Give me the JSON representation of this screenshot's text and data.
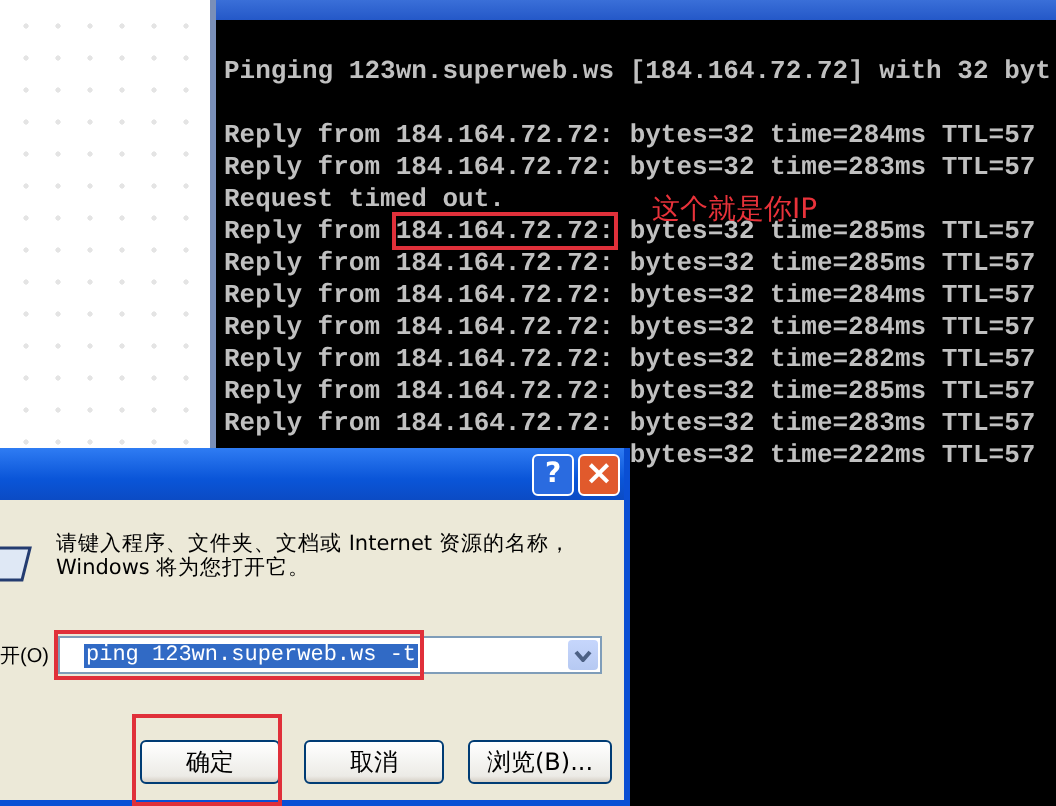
{
  "console": {
    "header": "Pinging 123wn.superweb.ws [184.164.72.72] with 32 byt",
    "lines": [
      {
        "text": "Reply from 184.164.72.72: bytes=32 time=284ms TTL=57"
      },
      {
        "text": "Reply from 184.164.72.72: bytes=32 time=283ms TTL=57"
      },
      {
        "text": "Request timed out."
      },
      {
        "text": "Reply from ",
        "framed": "184.164.72.72:",
        "after": " bytes=32 time=285ms TTL=57"
      },
      {
        "text": "Reply from 184.164.72.72: bytes=32 time=285ms TTL=57"
      },
      {
        "text": "Reply from 184.164.72.72: bytes=32 time=284ms TTL=57"
      },
      {
        "text": "Reply from 184.164.72.72: bytes=32 time=284ms TTL=57"
      },
      {
        "text": "Reply from 184.164.72.72: bytes=32 time=282ms TTL=57"
      },
      {
        "text": "Reply from 184.164.72.72: bytes=32 time=285ms TTL=57"
      },
      {
        "text": "Reply from 184.164.72.72: bytes=32 time=283ms TTL=57"
      },
      {
        "text": "                          bytes=32 time=222ms TTL=57"
      }
    ]
  },
  "annotation": {
    "label": "这个就是你IP"
  },
  "run_dialog": {
    "help": "?",
    "close": "×",
    "description": "请键入程序、文件夹、文档或 Internet 资源的名称，Windows 将为您打开它。",
    "open_label": "开(O)",
    "command": {
      "value": "ping 123wn.superweb.ws -t",
      "selected": true
    },
    "buttons": [
      {
        "label": "确定"
      },
      {
        "label": "取消"
      },
      {
        "label": "浏览(B)..."
      }
    ]
  }
}
